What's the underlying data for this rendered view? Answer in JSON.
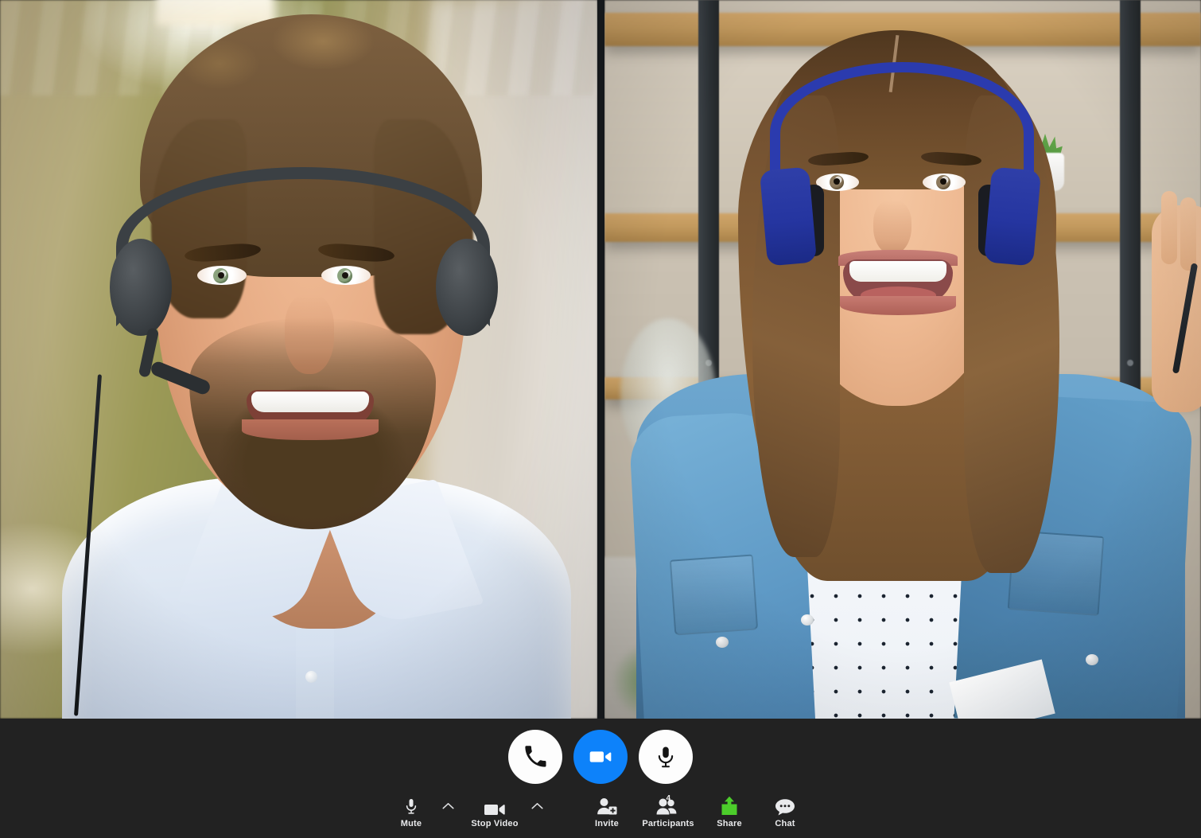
{
  "app": {
    "name": "video-call",
    "background_color": "#222222",
    "accent_color": "#0d82fa",
    "share_color": "#4ccd2b"
  },
  "video_grid": {
    "tiles": [
      {
        "id": "participant-left",
        "description": "Smiling bearded man wearing a black call-center headset with boom microphone, light blue dress shirt, blurred warm olive office background with ceiling lights"
      },
      {
        "id": "participant-right",
        "description": "Smiling young woman wearing blue on-ear headphones, denim shirt over white polka dot tee, wooden shelving unit background with potted plant"
      }
    ]
  },
  "main_controls": [
    {
      "name": "end-call-button",
      "icon": "phone-icon",
      "style": "light",
      "active": false
    },
    {
      "name": "video-button",
      "icon": "video-icon",
      "style": "accent",
      "active": true
    },
    {
      "name": "microphone-button",
      "icon": "mic-icon",
      "style": "light",
      "active": false
    }
  ],
  "toolbar": {
    "items": [
      {
        "name": "mute-button",
        "label": "Mute",
        "icon": "microphone-icon",
        "has_chevron": true,
        "badge": null
      },
      {
        "name": "stop-video-button",
        "label": "Stop Video",
        "icon": "video-camera-icon",
        "has_chevron": true,
        "badge": null
      },
      {
        "name": "invite-button",
        "label": "Invite",
        "icon": "person-add-icon",
        "has_chevron": false,
        "badge": null
      },
      {
        "name": "participants-button",
        "label": "Participants",
        "icon": "people-icon",
        "has_chevron": false,
        "badge": "4"
      },
      {
        "name": "share-button",
        "label": "Share",
        "icon": "share-screen-icon",
        "has_chevron": false,
        "badge": null
      },
      {
        "name": "chat-button",
        "label": "Chat",
        "icon": "chat-bubble-icon",
        "has_chevron": false,
        "badge": null
      }
    ]
  }
}
